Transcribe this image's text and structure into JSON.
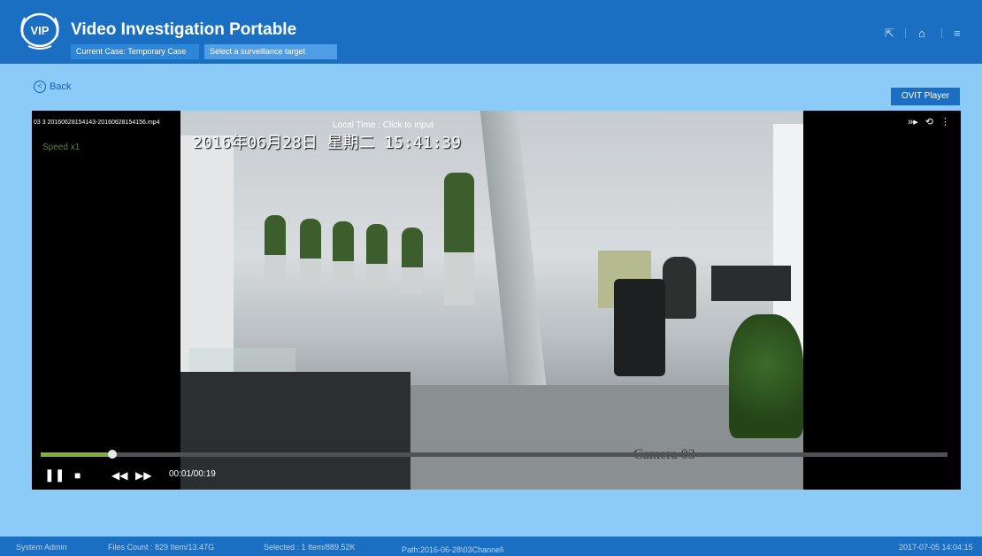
{
  "app": {
    "title": "Video Investigation Portable",
    "logo_text": "VIP"
  },
  "header": {
    "current_case": "Current Case: Temporary Case",
    "select_target": "Select a surveillance target",
    "icons": [
      "export-icon",
      "home-icon",
      "menu-icon"
    ]
  },
  "toolbar": {
    "back_label": "Back",
    "ovit_player_label": "OVIT Player"
  },
  "player": {
    "file_name": "03 3 20160628154143-20160628154156.mp4",
    "speed": "Speed x1",
    "local_time_label": "Local Time : Click to input",
    "timestamp_overlay": "2016年06月28日 星期二 15:41:39",
    "camera_label": "Camera 03",
    "timecode": "00:01/00:19",
    "progress_fraction": 0.079,
    "accent_color": "#7db33a"
  },
  "status_bar": {
    "user": "System Admin",
    "files_count": "Files Count : 829 Item/13.47G",
    "selected": "Selected : 1 Item/889.52K",
    "path": "Path:2016-06-28\\03Channel\\",
    "datetime": "2017-07-05 14:04:15"
  },
  "colors": {
    "header_bg": "#1a6fc2",
    "page_bg": "#8ccbf7"
  }
}
